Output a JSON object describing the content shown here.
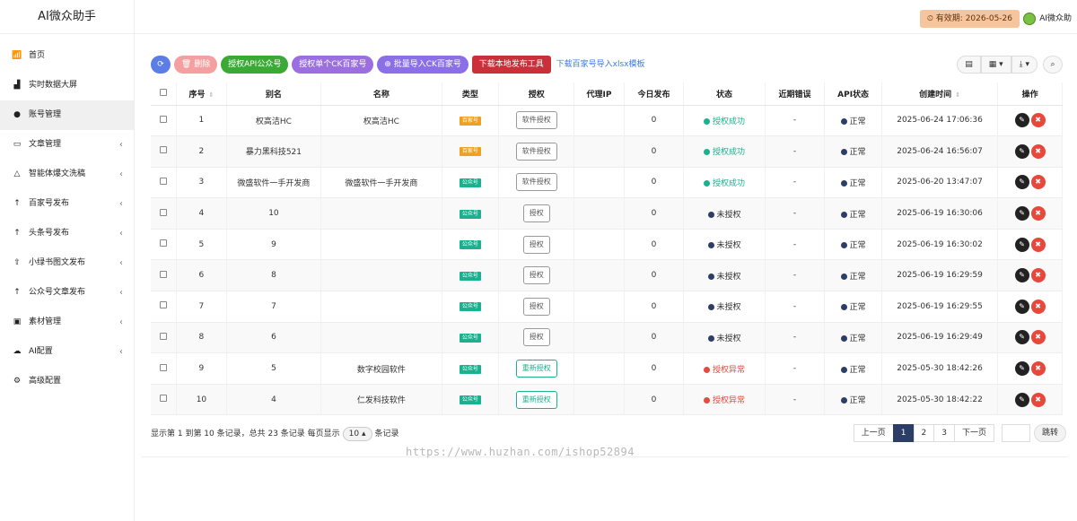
{
  "brand": "AI微众助手",
  "topbar": {
    "valid_label": "有效期: 2026-05-26",
    "user_name": "AI微众助"
  },
  "menu": [
    {
      "icon": "bar-chart-icon",
      "glyph": "📶",
      "label": "首页",
      "arrow": false
    },
    {
      "icon": "area-chart-icon",
      "glyph": "▟",
      "label": "实时数据大屏",
      "arrow": false
    },
    {
      "icon": "wechat-icon",
      "glyph": "●",
      "label": "账号管理",
      "arrow": false,
      "active": true
    },
    {
      "icon": "folder-icon",
      "glyph": "▭",
      "label": "文章管理",
      "arrow": true
    },
    {
      "icon": "triangle-icon",
      "glyph": "△",
      "label": "智能体爆文洗稿",
      "arrow": true
    },
    {
      "icon": "arrow-up-icon",
      "glyph": "↑",
      "label": "百家号发布",
      "arrow": true
    },
    {
      "icon": "arrow-up-icon",
      "glyph": "↑",
      "label": "头条号发布",
      "arrow": true
    },
    {
      "icon": "upload-icon",
      "glyph": "⇧",
      "label": "小绿书图文发布",
      "arrow": true
    },
    {
      "icon": "arrow-up-icon",
      "glyph": "↑",
      "label": "公众号文章发布",
      "arrow": true
    },
    {
      "icon": "image-icon",
      "glyph": "▣",
      "label": "素材管理",
      "arrow": true
    },
    {
      "icon": "cloud-icon",
      "glyph": "☁",
      "label": "AI配置",
      "arrow": true
    },
    {
      "icon": "gear-icon",
      "glyph": "⚙",
      "label": "高级配置",
      "arrow": false
    }
  ],
  "toolbar": {
    "delete": "删除",
    "auth_api": "授权API公众号",
    "auth_ck": "授权单个CK百家号",
    "batch_import": "批量导入CK百家号",
    "download_tool": "下载本地发布工具",
    "download_template": "下载百家号导入xlsx模板"
  },
  "table": {
    "headers": [
      "序号",
      "别名",
      "名称",
      "类型",
      "授权",
      "代理IP",
      "今日发布",
      "状态",
      "近期错误",
      "API状态",
      "创建时间",
      "操作"
    ],
    "rows": [
      {
        "no": "1",
        "alias": "权高洁HC",
        "name": "权高洁HC",
        "type": "百家号",
        "type_kind": "bj",
        "auth": "软件授权",
        "auth_kind": "soft",
        "proxy": "",
        "today": "0",
        "status": "授权成功",
        "status_kind": "ok",
        "err": "-",
        "api": "正常",
        "created": "2025-06-24 17:06:36"
      },
      {
        "no": "2",
        "alias": "暴力黑科技521",
        "name": "",
        "type": "百家号",
        "type_kind": "bj",
        "auth": "软件授权",
        "auth_kind": "soft",
        "proxy": "",
        "today": "0",
        "status": "授权成功",
        "status_kind": "ok",
        "err": "-",
        "api": "正常",
        "created": "2025-06-24 16:56:07"
      },
      {
        "no": "3",
        "alias": "微盛软件一手开发商",
        "name": "微盛软件一手开发商",
        "type": "公众号",
        "type_kind": "gzh",
        "auth": "软件授权",
        "auth_kind": "soft",
        "proxy": "",
        "today": "0",
        "status": "授权成功",
        "status_kind": "ok",
        "err": "-",
        "api": "正常",
        "created": "2025-06-20 13:47:07"
      },
      {
        "no": "4",
        "alias": "10",
        "name": "",
        "type": "公众号",
        "type_kind": "gzh",
        "auth": "授权",
        "auth_kind": "soft",
        "proxy": "",
        "today": "0",
        "status": "未授权",
        "status_kind": "none",
        "err": "-",
        "api": "正常",
        "created": "2025-06-19 16:30:06"
      },
      {
        "no": "5",
        "alias": "9",
        "name": "",
        "type": "公众号",
        "type_kind": "gzh",
        "auth": "授权",
        "auth_kind": "soft",
        "proxy": "",
        "today": "0",
        "status": "未授权",
        "status_kind": "none",
        "err": "-",
        "api": "正常",
        "created": "2025-06-19 16:30:02"
      },
      {
        "no": "6",
        "alias": "8",
        "name": "",
        "type": "公众号",
        "type_kind": "gzh",
        "auth": "授权",
        "auth_kind": "soft",
        "proxy": "",
        "today": "0",
        "status": "未授权",
        "status_kind": "none",
        "err": "-",
        "api": "正常",
        "created": "2025-06-19 16:29:59"
      },
      {
        "no": "7",
        "alias": "7",
        "name": "",
        "type": "公众号",
        "type_kind": "gzh",
        "auth": "授权",
        "auth_kind": "soft",
        "proxy": "",
        "today": "0",
        "status": "未授权",
        "status_kind": "none",
        "err": "-",
        "api": "正常",
        "created": "2025-06-19 16:29:55"
      },
      {
        "no": "8",
        "alias": "6",
        "name": "",
        "type": "公众号",
        "type_kind": "gzh",
        "auth": "授权",
        "auth_kind": "soft",
        "proxy": "",
        "today": "0",
        "status": "未授权",
        "status_kind": "none",
        "err": "-",
        "api": "正常",
        "created": "2025-06-19 16:29:49"
      },
      {
        "no": "9",
        "alias": "5",
        "name": "数字校园软件",
        "type": "公众号",
        "type_kind": "gzh",
        "auth": "重新授权",
        "auth_kind": "re",
        "proxy": "",
        "today": "0",
        "status": "授权异常",
        "status_kind": "err",
        "err": "-",
        "api": "正常",
        "created": "2025-05-30 18:42:26"
      },
      {
        "no": "10",
        "alias": "4",
        "name": "仁发科技软件",
        "type": "公众号",
        "type_kind": "gzh",
        "auth": "重新授权",
        "auth_kind": "re",
        "proxy": "",
        "today": "0",
        "status": "授权异常",
        "status_kind": "err",
        "err": "-",
        "api": "正常",
        "created": "2025-05-30 18:42:22"
      }
    ]
  },
  "footer": {
    "summary_a": "显示第 1 到第 10 条记录，总共 23 条记录 每页显示",
    "page_size": "10",
    "summary_b": "条记录"
  },
  "pager": {
    "prev": "上一页",
    "pages": [
      "1",
      "2",
      "3"
    ],
    "next": "下一页",
    "jump": "跳转"
  },
  "watermark": "https://www.huzhan.com/ishop52894",
  "colors": {
    "ok": "#1bb18f",
    "err": "#e64a3d",
    "none": "#2c3e66",
    "api_dot": "#2c3e66"
  }
}
